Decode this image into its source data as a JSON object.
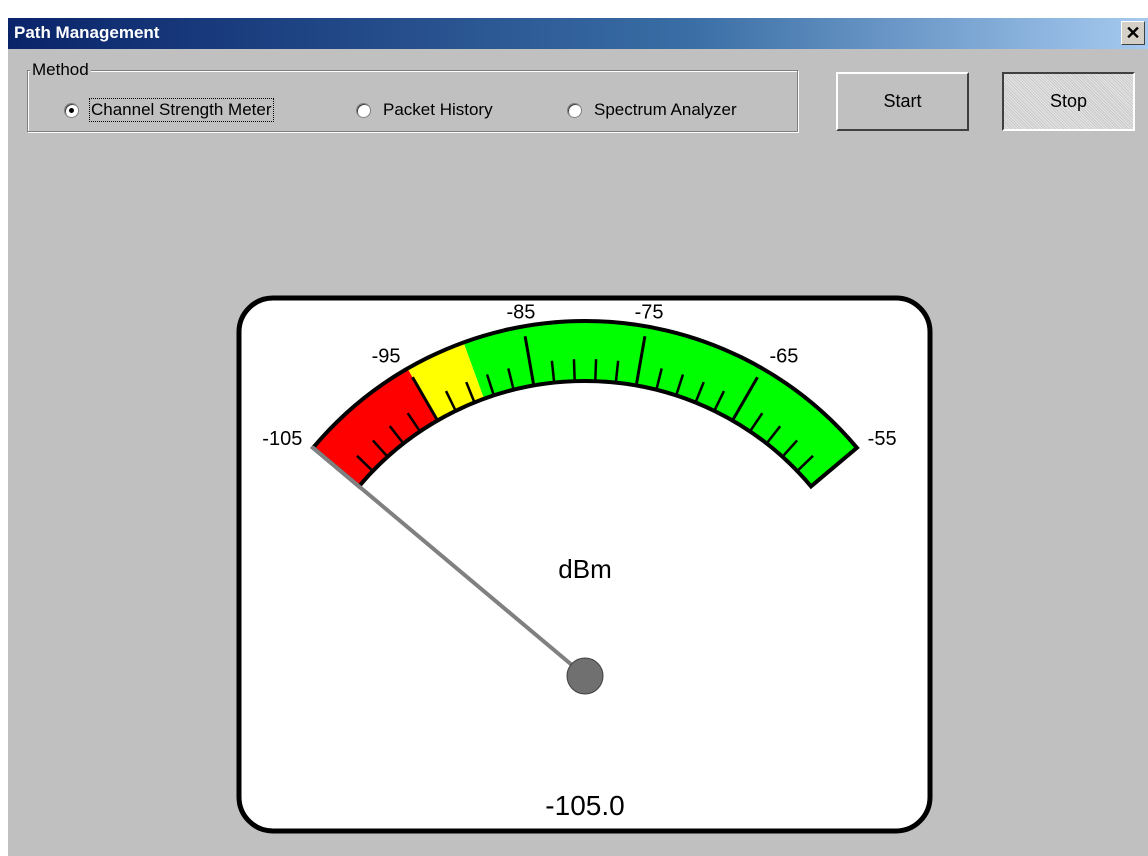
{
  "window": {
    "title": "Path Management",
    "close_glyph": "✕"
  },
  "method_group": {
    "legend": "Method",
    "options": [
      {
        "label": "Channel Strength Meter",
        "selected": true
      },
      {
        "label": "Packet History",
        "selected": false
      },
      {
        "label": "Spectrum Analyzer",
        "selected": false
      }
    ]
  },
  "buttons": {
    "start": "Start",
    "stop": "Stop"
  },
  "gauge": {
    "unit": "dBm",
    "value": -105.0,
    "value_text": "-105.0",
    "min": -105,
    "max": -55,
    "major_labels": [
      "-105",
      "-95",
      "-85",
      "-75",
      "-65",
      "-55"
    ],
    "zones": [
      {
        "from": -105,
        "to": -95,
        "color": "#ff0000"
      },
      {
        "from": -95,
        "to": -90,
        "color": "#ffff00"
      },
      {
        "from": -90,
        "to": -55,
        "color": "#00ff00"
      }
    ],
    "needle_color": "#808080",
    "hub_color": "#707070"
  }
}
